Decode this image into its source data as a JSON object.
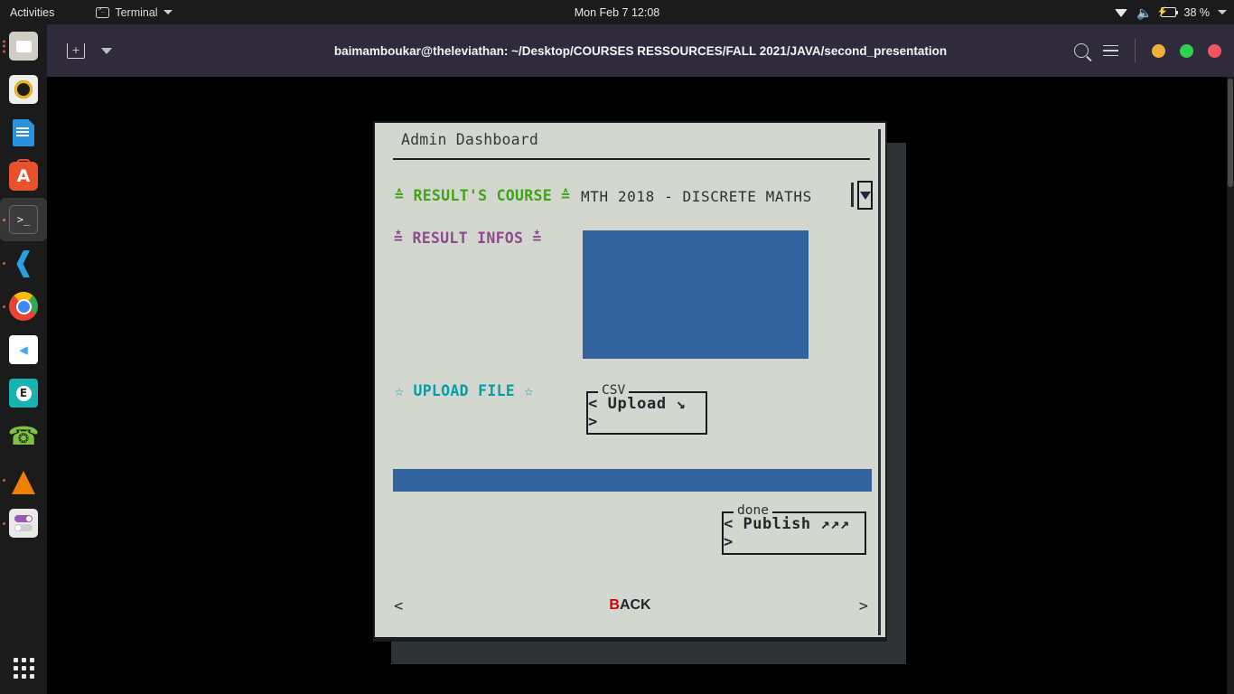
{
  "topbar": {
    "activities": "Activities",
    "app_name": "Terminal",
    "app_icon": "terminal-icon",
    "clock": "Mon Feb 7  12:08",
    "wifi_icon": "wifi-icon",
    "volume_icon": "volume-muted-icon",
    "battery_icon": "battery-charging-icon",
    "battery": "38 %",
    "menu_caret": "chevron-down-icon"
  },
  "dock": {
    "items": [
      {
        "name": "files",
        "icon": "files-icon",
        "running": true,
        "active": false
      },
      {
        "name": "rhythmbox",
        "icon": "rhythmbox-icon",
        "running": false,
        "active": false
      },
      {
        "name": "writer",
        "icon": "libreoffice-writer-icon",
        "running": false,
        "active": false
      },
      {
        "name": "software",
        "icon": "ubuntu-software-icon",
        "running": false,
        "active": false
      },
      {
        "name": "terminal",
        "icon": "terminal-icon",
        "running": true,
        "active": true
      },
      {
        "name": "vscode",
        "icon": "vscode-icon",
        "running": true,
        "active": false
      },
      {
        "name": "chrome",
        "icon": "chrome-icon",
        "running": true,
        "active": false
      },
      {
        "name": "flutter",
        "icon": "flutter-icon",
        "running": false,
        "active": false
      },
      {
        "name": "eclipse",
        "icon": "eclipse-icon",
        "running": false,
        "active": false
      },
      {
        "name": "whatsapp",
        "icon": "whatsapp-icon",
        "running": false,
        "active": false
      },
      {
        "name": "vlc",
        "icon": "vlc-icon",
        "running": true,
        "active": false
      },
      {
        "name": "settings",
        "icon": "settings-icon",
        "running": true,
        "active": false
      }
    ],
    "show_apps": "show-applications-icon"
  },
  "terminal_window": {
    "title": "baimamboukar@theleviathan: ~/Desktop/COURSES RESSOURCES/FALL 2021/JAVA/second_presentation",
    "new_tab_icon": "new-tab-icon",
    "tab_menu_icon": "chevron-down-icon",
    "search_icon": "search-icon",
    "menu_icon": "hamburger-menu-icon",
    "minimize": "minimize-button",
    "maximize": "maximize-button",
    "close": "close-button"
  },
  "dialog": {
    "title": "Admin Dashboard",
    "course": {
      "label": "≙ RESULT'S COURSE ≙",
      "label_color": "#3fa514",
      "selected": "MTH 2018 - DISCRETE MATHS",
      "dropdown_icon": "chevron-down-icon"
    },
    "infos": {
      "label": "≛ RESULT INFOS ≛",
      "label_color": "#8e4a8e",
      "value": "",
      "fill_color": "#33639f"
    },
    "upload": {
      "label": "☆ UPLOAD FILE ☆",
      "label_color": "#00a0a8",
      "fieldset_legend": "CSV",
      "button_label": "< Upload ↘ >"
    },
    "progress": {
      "value": "",
      "color": "#33639f"
    },
    "publish": {
      "fieldset_legend": "done",
      "button_label": "< Publish ↗↗↗ >"
    },
    "nav": {
      "prev": "<",
      "next": ">",
      "center_mnemonic": "B",
      "center_rest": "ACK"
    }
  }
}
